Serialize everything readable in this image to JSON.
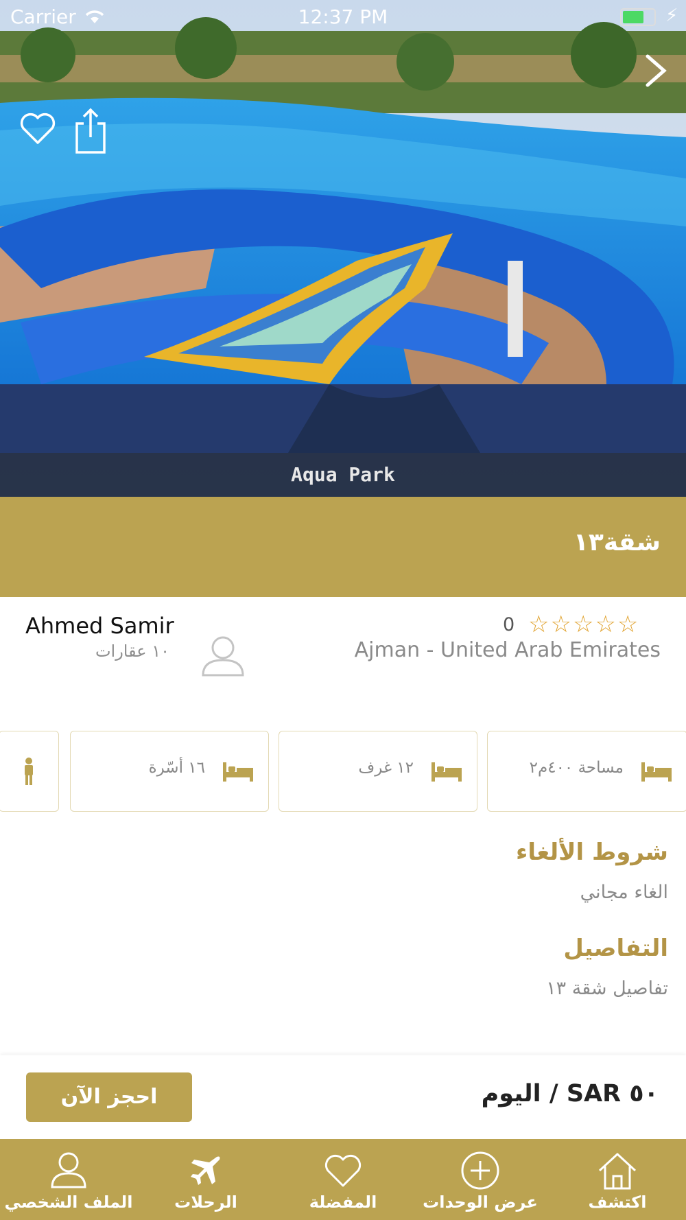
{
  "status_bar": {
    "carrier": "Carrier",
    "time": "12:37 PM"
  },
  "hero": {
    "caption": "Aqua Park"
  },
  "listing": {
    "title": "شقة١٣"
  },
  "owner": {
    "name": "Ahmed Samir",
    "properties": "١٠ عقارات"
  },
  "rating": {
    "count": "0",
    "stars": "☆☆☆☆☆",
    "max": 5,
    "value": 0
  },
  "location": "Ajman - United Arab Emirates",
  "features": [
    {
      "label": "مساحة ٤٠٠م٢",
      "icon": "bed-icon"
    },
    {
      "label": "١٢ غرف",
      "icon": "bed-icon"
    },
    {
      "label": "١٦ أسّرة",
      "icon": "bed-icon"
    },
    {
      "label": "",
      "icon": "person-icon"
    }
  ],
  "cancellation": {
    "title": "شروط الألغاء",
    "text": "الغاء مجاني"
  },
  "details": {
    "title": "التفاصيل",
    "text": "تفاصيل شقة ١٣"
  },
  "booking": {
    "book_label": "احجز الآن",
    "price": "٥٠ SAR / اليوم"
  },
  "tabs": [
    {
      "label": "الملف الشخصي",
      "icon": "profile-icon"
    },
    {
      "label": "الرحلات",
      "icon": "plane-icon"
    },
    {
      "label": "المفضلة",
      "icon": "heart-icon"
    },
    {
      "label": "عرض الوحدات",
      "icon": "plus-circle-icon"
    },
    {
      "label": "اكتشف",
      "icon": "home-icon"
    }
  ],
  "colors": {
    "brand_gold": "#bba351",
    "star": "#e1a32f",
    "title_gold": "#b39446"
  }
}
